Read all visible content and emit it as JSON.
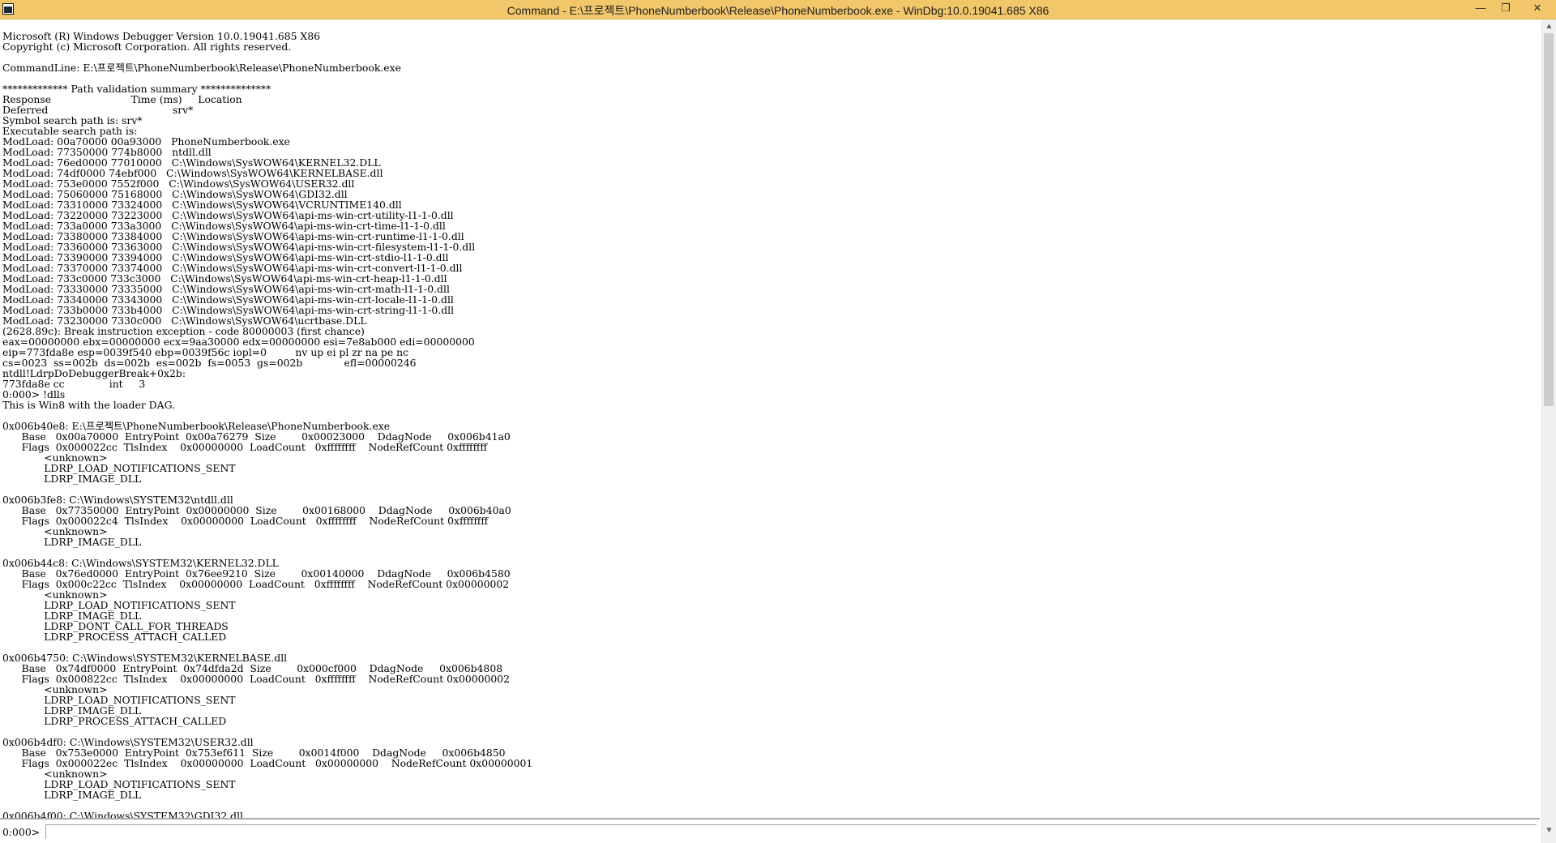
{
  "window": {
    "title": "Command - E:\\프로젝트\\PhoneNumberbook\\Release\\PhoneNumberbook.exe - WinDbg:10.0.19041.685 X86",
    "minimize_glyph": "—",
    "maximize_glyph": "❐",
    "close_glyph": "✕"
  },
  "output": {
    "lines": [
      "Microsoft (R) Windows Debugger Version 10.0.19041.685 X86",
      "Copyright (c) Microsoft Corporation. All rights reserved.",
      "",
      "CommandLine: E:\\프로젝트\\PhoneNumberbook\\Release\\PhoneNumberbook.exe",
      "",
      "************* Path validation summary **************",
      "Response                         Time (ms)     Location",
      "Deferred                                       srv*",
      "Symbol search path is: srv*",
      "Executable search path is:",
      "ModLoad: 00a70000 00a93000   PhoneNumberbook.exe",
      "ModLoad: 77350000 774b8000   ntdll.dll",
      "ModLoad: 76ed0000 77010000   C:\\Windows\\SysWOW64\\KERNEL32.DLL",
      "ModLoad: 74df0000 74ebf000   C:\\Windows\\SysWOW64\\KERNELBASE.dll",
      "ModLoad: 753e0000 7552f000   C:\\Windows\\SysWOW64\\USER32.dll",
      "ModLoad: 75060000 75168000   C:\\Windows\\SysWOW64\\GDI32.dll",
      "ModLoad: 73310000 73324000   C:\\Windows\\SysWOW64\\VCRUNTIME140.dll",
      "ModLoad: 73220000 73223000   C:\\Windows\\SysWOW64\\api-ms-win-crt-utility-l1-1-0.dll",
      "ModLoad: 733a0000 733a3000   C:\\Windows\\SysWOW64\\api-ms-win-crt-time-l1-1-0.dll",
      "ModLoad: 73380000 73384000   C:\\Windows\\SysWOW64\\api-ms-win-crt-runtime-l1-1-0.dll",
      "ModLoad: 73360000 73363000   C:\\Windows\\SysWOW64\\api-ms-win-crt-filesystem-l1-1-0.dll",
      "ModLoad: 73390000 73394000   C:\\Windows\\SysWOW64\\api-ms-win-crt-stdio-l1-1-0.dll",
      "ModLoad: 73370000 73374000   C:\\Windows\\SysWOW64\\api-ms-win-crt-convert-l1-1-0.dll",
      "ModLoad: 733c0000 733c3000   C:\\Windows\\SysWOW64\\api-ms-win-crt-heap-l1-1-0.dll",
      "ModLoad: 73330000 73335000   C:\\Windows\\SysWOW64\\api-ms-win-crt-math-l1-1-0.dll",
      "ModLoad: 73340000 73343000   C:\\Windows\\SysWOW64\\api-ms-win-crt-locale-l1-1-0.dll",
      "ModLoad: 733b0000 733b4000   C:\\Windows\\SysWOW64\\api-ms-win-crt-string-l1-1-0.dll",
      "ModLoad: 73230000 7330c000   C:\\Windows\\SysWOW64\\ucrtbase.DLL",
      "(2628.89c): Break instruction exception - code 80000003 (first chance)",
      "eax=00000000 ebx=00000000 ecx=9aa30000 edx=00000000 esi=7e8ab000 edi=00000000",
      "eip=773fda8e esp=0039f540 ebp=0039f56c iopl=0         nv up ei pl zr na pe nc",
      "cs=0023  ss=002b  ds=002b  es=002b  fs=0053  gs=002b             efl=00000246",
      "ntdll!LdrpDoDebuggerBreak+0x2b:",
      "773fda8e cc              int     3",
      "0:000> !dlls",
      "This is Win8 with the loader DAG.",
      "",
      "0x006b40e8: E:\\프로젝트\\PhoneNumberbook\\Release\\PhoneNumberbook.exe",
      "      Base   0x00a70000  EntryPoint  0x00a76279  Size        0x00023000    DdagNode     0x006b41a0",
      "      Flags  0x000022cc  TlsIndex    0x00000000  LoadCount   0xffffffff    NodeRefCount 0xffffffff",
      "             <unknown>",
      "             LDRP_LOAD_NOTIFICATIONS_SENT",
      "             LDRP_IMAGE_DLL",
      "",
      "0x006b3fe8: C:\\Windows\\SYSTEM32\\ntdll.dll",
      "      Base   0x77350000  EntryPoint  0x00000000  Size        0x00168000    DdagNode     0x006b40a0",
      "      Flags  0x000022c4  TlsIndex    0x00000000  LoadCount   0xffffffff    NodeRefCount 0xffffffff",
      "             <unknown>",
      "             LDRP_IMAGE_DLL",
      "",
      "0x006b44c8: C:\\Windows\\SYSTEM32\\KERNEL32.DLL",
      "      Base   0x76ed0000  EntryPoint  0x76ee9210  Size        0x00140000    DdagNode     0x006b4580",
      "      Flags  0x000c22cc  TlsIndex    0x00000000  LoadCount   0xffffffff    NodeRefCount 0x00000002",
      "             <unknown>",
      "             LDRP_LOAD_NOTIFICATIONS_SENT",
      "             LDRP_IMAGE_DLL",
      "             LDRP_DONT_CALL_FOR_THREADS",
      "             LDRP_PROCESS_ATTACH_CALLED",
      "",
      "0x006b4750: C:\\Windows\\SYSTEM32\\KERNELBASE.dll",
      "      Base   0x74df0000  EntryPoint  0x74dfda2d  Size        0x000cf000    DdagNode     0x006b4808",
      "      Flags  0x000822cc  TlsIndex    0x00000000  LoadCount   0xffffffff    NodeRefCount 0x00000002",
      "             <unknown>",
      "             LDRP_LOAD_NOTIFICATIONS_SENT",
      "             LDRP_IMAGE_DLL",
      "             LDRP_PROCESS_ATTACH_CALLED",
      "",
      "0x006b4df0: C:\\Windows\\SYSTEM32\\USER32.dll",
      "      Base   0x753e0000  EntryPoint  0x753ef611  Size        0x0014f000    DdagNode     0x006b4850",
      "      Flags  0x000022ec  TlsIndex    0x00000000  LoadCount   0x00000000    NodeRefCount 0x00000001",
      "             <unknown>",
      "             LDRP_LOAD_NOTIFICATIONS_SENT",
      "             LDRP_IMAGE_DLL",
      "",
      "0x006b4f00: C:\\Windows\\SYSTEM32\\GDI32.dll"
    ]
  },
  "command_bar": {
    "prompt": "0:000>",
    "input_value": ""
  },
  "scrollbar": {
    "up_glyph": "▲",
    "down_glyph": "▼"
  }
}
